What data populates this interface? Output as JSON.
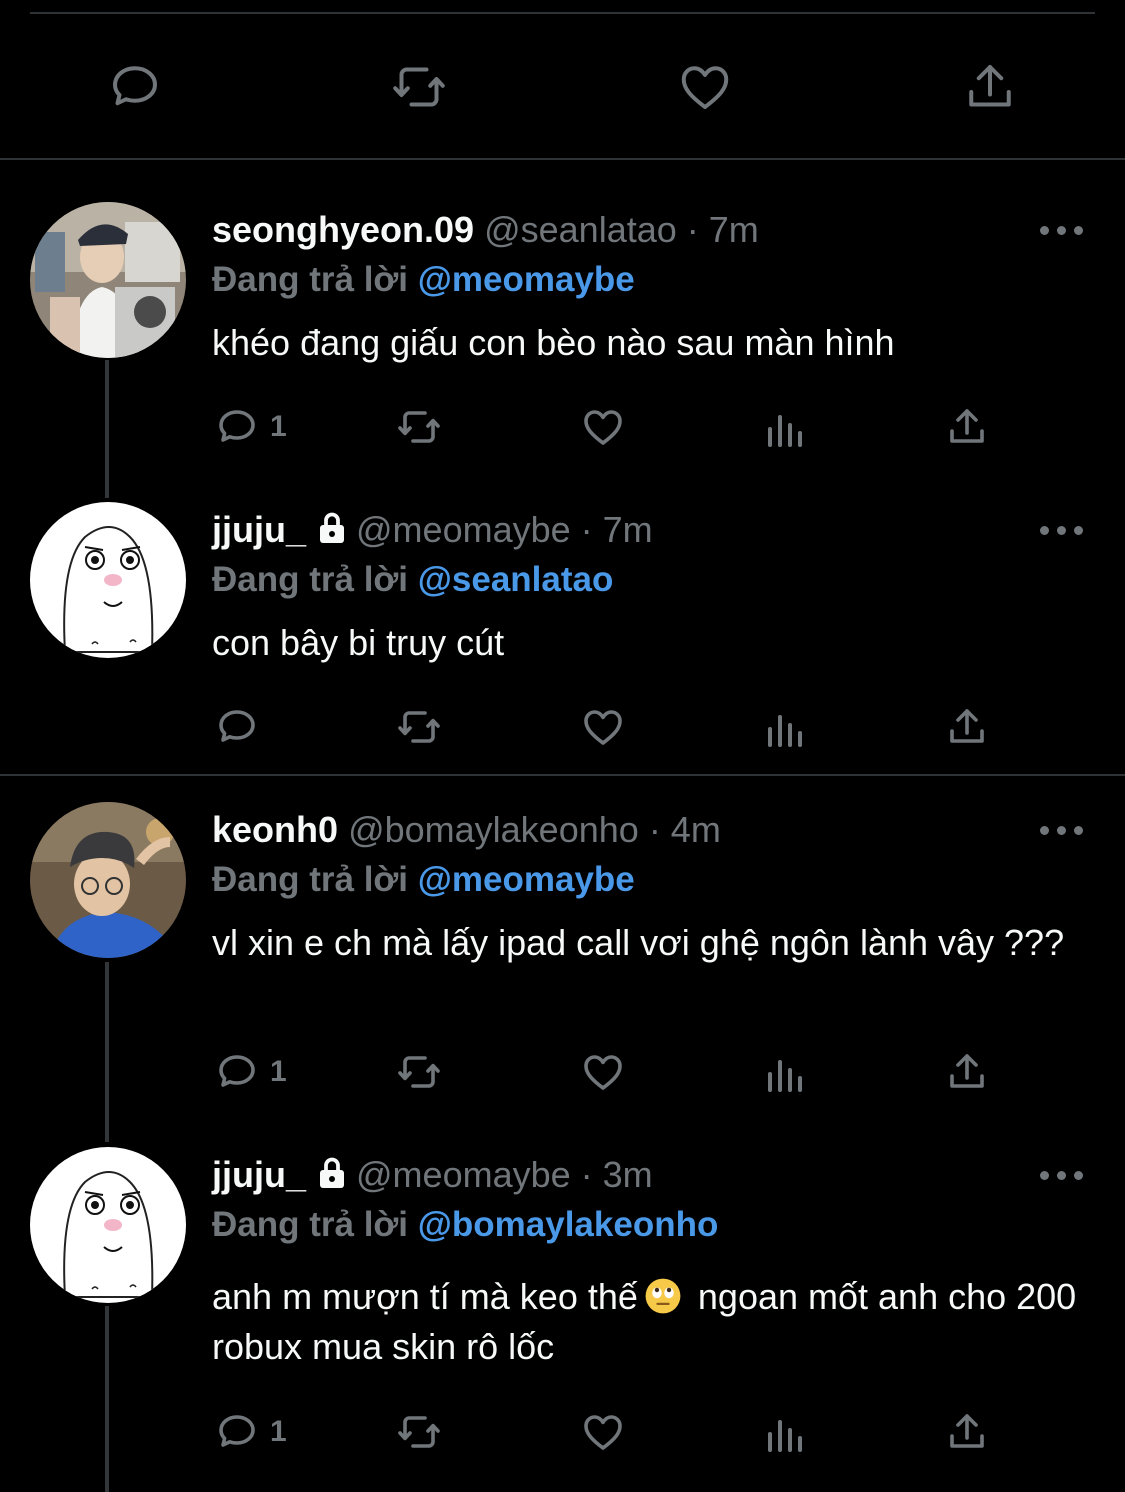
{
  "colors": {
    "background": "#000000",
    "muted": "#71767b",
    "text": "#f7f9f9",
    "mention": "#4a99e9",
    "divider": "#2f3336"
  },
  "top_actions": [
    "reply-icon",
    "retweet-icon",
    "like-icon",
    "share-icon"
  ],
  "tweets": [
    {
      "name": "seonghyeon.09",
      "handle": "@seanlatao",
      "time": "· 7m",
      "protected": false,
      "replying_label": "Đang trả lời",
      "replying_to": "@meomaybe",
      "text": "khéo đang giấu con bèo nào sau màn hình",
      "reply_count": "1"
    },
    {
      "name": "jjuju_",
      "handle": "@meomaybe",
      "time": "· 7m",
      "protected": true,
      "replying_label": "Đang trả lời",
      "replying_to": "@seanlatao",
      "text": "con bây bi truy cút",
      "reply_count": ""
    },
    {
      "name": "keonh0",
      "handle": "@bomaylakeonho",
      "time": "· 4m",
      "protected": false,
      "replying_label": "Đang trả lời",
      "replying_to": "@meomaybe",
      "text": "vl xin e ch mà lấy ipad call vơi ghệ ngôn lành vây ???",
      "reply_count": "1"
    },
    {
      "name": "jjuju_",
      "handle": "@meomaybe",
      "time": "· 3m",
      "protected": true,
      "replying_label": "Đang trả lời",
      "replying_to": "@bomaylakeonho",
      "text_before_emoji": "anh m mượn tí mà keo thế",
      "emoji": "face-with-rolling-eyes-emoji",
      "text_after_emoji": "ngoan mốt anh cho 200 robux mua skin rô lốc",
      "reply_count": "1"
    }
  ]
}
